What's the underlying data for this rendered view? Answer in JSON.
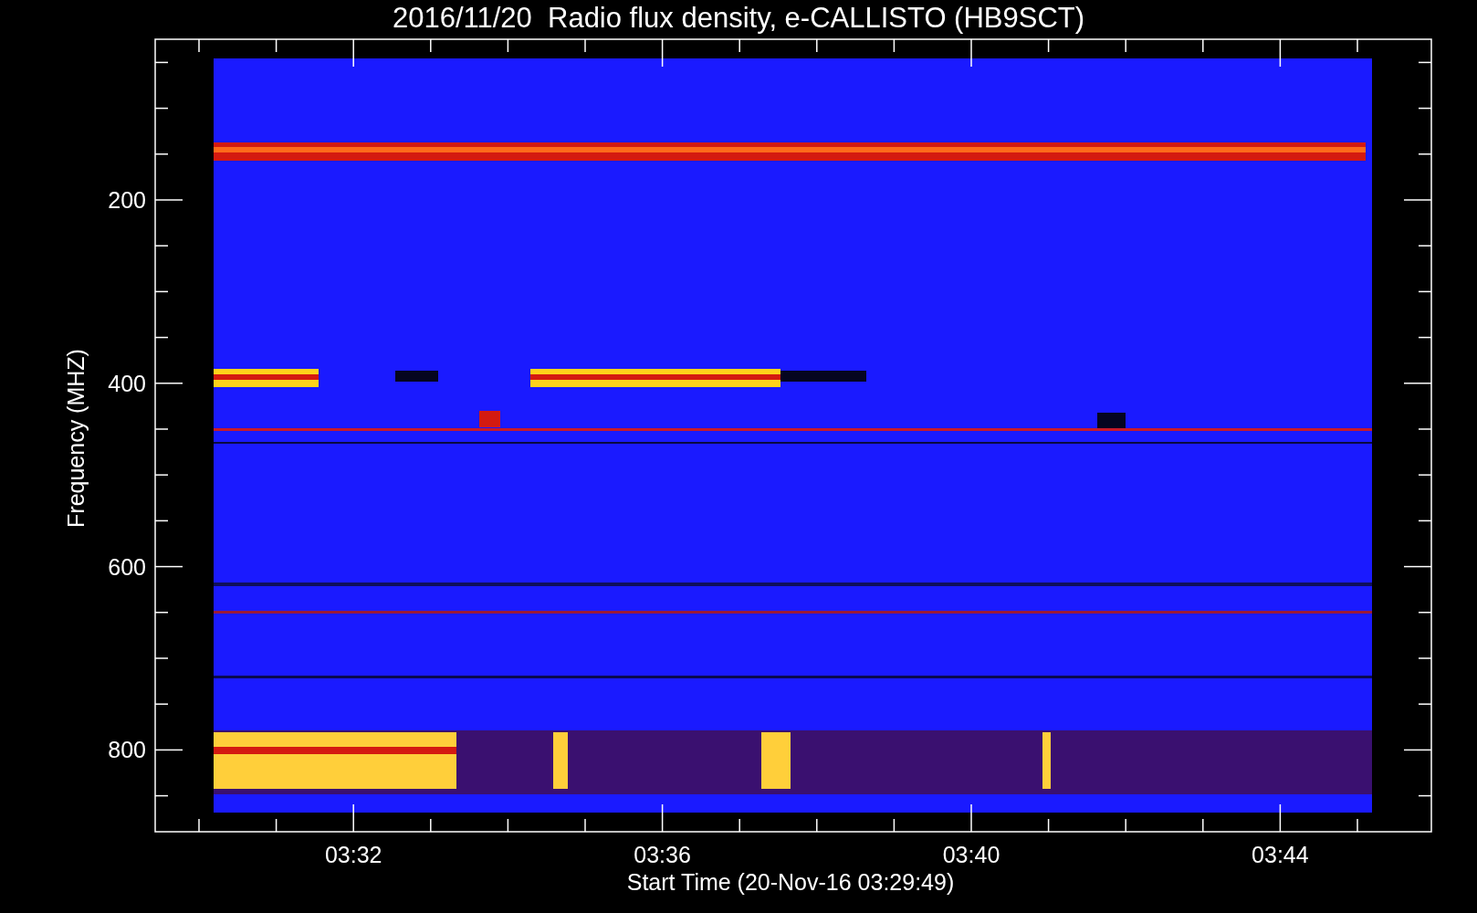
{
  "title": "2016/11/20  Radio flux density, e-CALLISTO (HB9SCT)",
  "y_axis": {
    "label": "Frequency (MHZ)",
    "ticks": [
      "200",
      "400",
      "600",
      "800"
    ]
  },
  "x_axis": {
    "label": "Start Time (20-Nov-16 03:29:49)",
    "ticks": [
      "03:32",
      "03:36",
      "03:40",
      "03:44"
    ]
  }
}
